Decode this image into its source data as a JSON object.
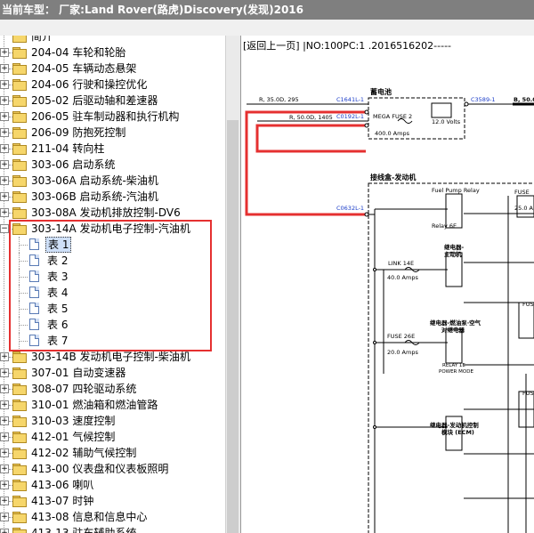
{
  "title": "当前车型： 厂家:Land Rover(路虎)Discovery(发现)2016",
  "tree": {
    "top_partial": "简介",
    "before": [
      {
        "label": "204-04 车轮和轮胎"
      },
      {
        "label": "204-05 车辆动态悬架"
      },
      {
        "label": "204-06 行驶和操控优化"
      },
      {
        "label": "205-02 后驱动轴和差速器"
      },
      {
        "label": "206-05 驻车制动器和执行机构"
      },
      {
        "label": "206-09 防抱死控制"
      },
      {
        "label": "211-04 转向柱"
      },
      {
        "label": "303-06 启动系统"
      },
      {
        "label": "303-06A 启动系统-柴油机"
      },
      {
        "label": "303-06B 启动系统-汽油机"
      },
      {
        "label": "303-08A 发动机排放控制-DV6"
      }
    ],
    "expanded": {
      "label": "303-14A 发动机电子控制-汽油机"
    },
    "children": [
      {
        "label": "表 1"
      },
      {
        "label": "表 2"
      },
      {
        "label": "表 3"
      },
      {
        "label": "表 4"
      },
      {
        "label": "表 5"
      },
      {
        "label": "表 6"
      },
      {
        "label": "表 7"
      }
    ],
    "after": [
      {
        "label": "303-14B 发动机电子控制-柴油机"
      },
      {
        "label": "307-01 自动变速器"
      },
      {
        "label": "308-07 四轮驱动系统"
      },
      {
        "label": "310-01 燃油箱和燃油管路"
      },
      {
        "label": "310-03 速度控制"
      },
      {
        "label": "412-01 气候控制"
      },
      {
        "label": "412-02 辅助气候控制"
      },
      {
        "label": "413-00 仪表盘和仪表板照明"
      },
      {
        "label": "413-06 喇叭"
      },
      {
        "label": "413-07 时钟"
      },
      {
        "label": "413-08 信息和信息中心"
      },
      {
        "label": "413-13 驻车辅助系统"
      }
    ]
  },
  "content": {
    "nav": "[返回上一页] |NO:100PC:1 .2016516202-----"
  },
  "diagram": {
    "battery_label": "蓄电池",
    "wire1": "R, 35.0D, 295",
    "wire2": "R, 50.0D, 1405",
    "conn1": "C1641L-1",
    "conn2": "C0192L-1",
    "conn3": "C3589-1",
    "conn4": "C0632L-1",
    "wire_right": "B, 50.0",
    "fuse_mega": "MEGA FUSE 2",
    "fuse_mega_amps": "400.0 Amps",
    "volts": "12.0 Volts",
    "box_label": "接线盒-发动机",
    "fuel_relay": "Fuel Pump Relay",
    "relay_6e": "Relay 6E",
    "fuse_r1": "FUSE",
    "amps_r1": "25.0 A",
    "relay2": "继电器-",
    "relay2b": "主动机",
    "link": "LINK 14E",
    "link_amps": "40.0 Amps",
    "fuse_r2": "FUS",
    "relay3": "继电器-燃油泵·空气",
    "relay3b": "对继电器",
    "fuse_26e": "FUSE 26E",
    "fuse_26e_amps": "20.0 Amps",
    "relay_1e": "RELAY 1E",
    "power_mode": "POWER MODE",
    "relay4": "继电器-发动机控制",
    "relay4b": "模块 (ECM)",
    "fuse_r3": "FUSE"
  },
  "colors": {
    "highlight": "#e53030",
    "title_bg": "#7f7f7f",
    "tree_selected": "#cfe0f8"
  }
}
